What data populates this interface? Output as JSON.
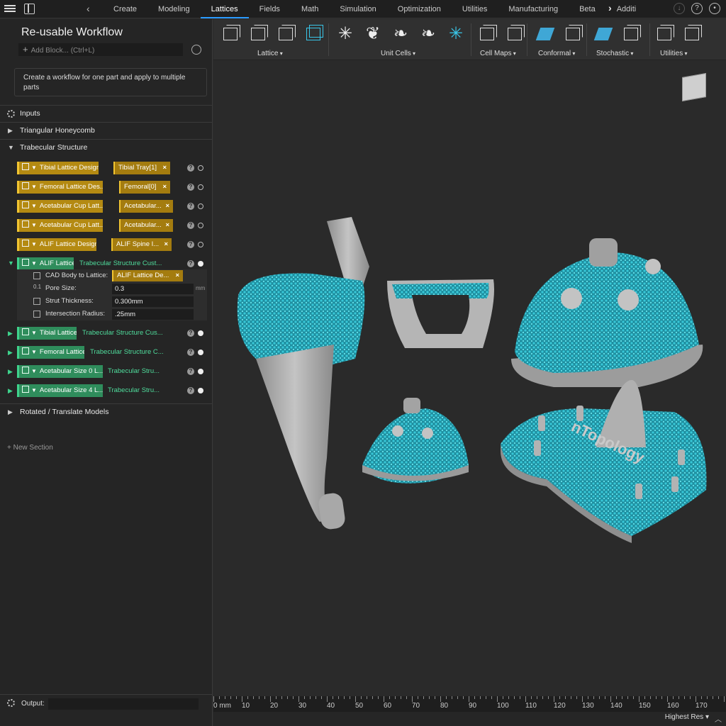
{
  "topbar": {
    "tabs": [
      "Create",
      "Modeling",
      "Lattices",
      "Fields",
      "Math",
      "Simulation",
      "Optimization",
      "Utilities",
      "Manufacturing",
      "Beta",
      "Additi"
    ],
    "active_tab": "Lattices"
  },
  "sidebar": {
    "title": "Re-usable Workflow",
    "add_block_label": "Add Block... (Ctrl+L)",
    "description": "Create a workflow for one part and apply to multiple parts",
    "sections": {
      "inputs": "Inputs",
      "triangular": "Triangular Honeycomb",
      "trabecular": "Trabecular Structure",
      "rotated": "Rotated / Translate Models"
    },
    "blocks": [
      {
        "label": "Tibial Lattice Design",
        "value": "Tibial Tray[1]"
      },
      {
        "label": "Femoral Lattice Des...",
        "value": "Femoral[0]"
      },
      {
        "label": "Acetabular Cup Latt...",
        "value": "Acetabular..."
      },
      {
        "label": "Acetabular Cup Latt...",
        "value": "Acetabular..."
      },
      {
        "label": "ALIF Lattice Design",
        "value": "ALIF Spine I..."
      }
    ],
    "alif": {
      "label": "ALIF Lattice",
      "type": "Trabecular Structure Cust...",
      "props": [
        {
          "label": "CAD Body to Lattice:",
          "value": "ALIF Lattice De...",
          "unit": ""
        },
        {
          "label": "Pore Size:",
          "value": "0.3",
          "unit": "mm"
        },
        {
          "label": "Strut Thickness:",
          "value": "0.300mm",
          "unit": ""
        },
        {
          "label": "Intersection Radius:",
          "value": ".25mm",
          "unit": ""
        }
      ],
      "num_icon": "0.1"
    },
    "green_blocks": [
      {
        "label": "Tibial Lattice",
        "type": "Trabecular Structure Cus..."
      },
      {
        "label": "Femoral Lattice",
        "type": "Trabecular Structure C..."
      },
      {
        "label": "Acetabular Size 0 L...",
        "type": "Trabecular Stru..."
      },
      {
        "label": "Acetabular Size 4 L...",
        "type": "Trabecular Stru..."
      }
    ],
    "new_section": "New Section",
    "output_label": "Output:"
  },
  "toolbar": {
    "groups": [
      "Lattice",
      "Unit Cells",
      "Cell Maps",
      "Conformal",
      "Stochastic",
      "Utilities"
    ]
  },
  "viewport": {
    "brand_text": "nTopology",
    "lattice_color": "#2fb8c8",
    "part_color": "#a9a9a9"
  },
  "ruler": {
    "labels": [
      "0 mm",
      "10",
      "20",
      "30",
      "40",
      "50",
      "60",
      "70",
      "80",
      "90",
      "100",
      "110",
      "120",
      "130",
      "140",
      "150",
      "160",
      "170"
    ]
  },
  "status": {
    "resolution": "Highest Res"
  }
}
